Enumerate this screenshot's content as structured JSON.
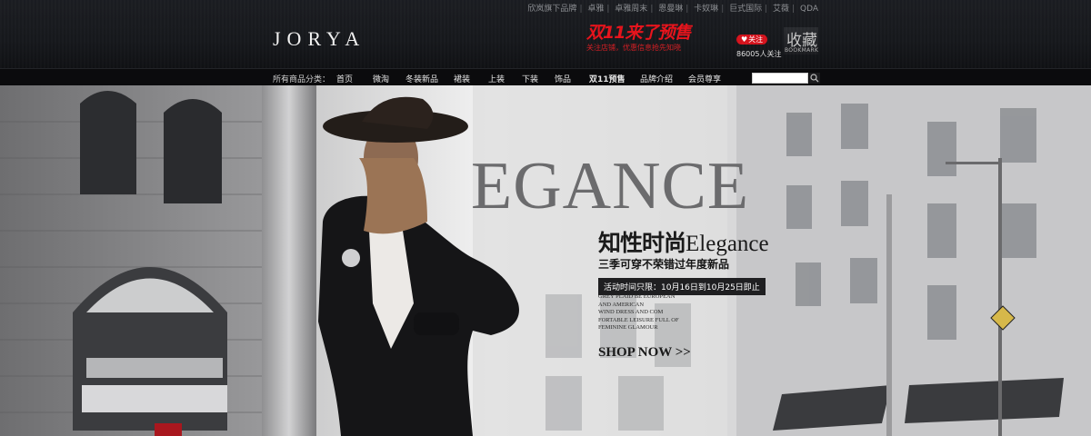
{
  "top_links": [
    "欣岚旗下品牌",
    "卓雅",
    "卓雅周末",
    "恩曼琳",
    "卡奴琳",
    "巨式国际",
    "艾薇",
    "QDA"
  ],
  "brand": {
    "logo": "JORYA"
  },
  "promo": {
    "title": "双11来了预售",
    "subtitle": "关注店铺，优惠信息抢先知晓"
  },
  "follow": {
    "button": "关注",
    "count": "86005人关注"
  },
  "bookmark": {
    "big": "收藏",
    "small": "BOOKMARK"
  },
  "nav": {
    "category_label": "所有商品分类：",
    "items": [
      "首页",
      "微淘",
      "冬装新品",
      "裙装",
      "上装",
      "下装",
      "饰品",
      "双11预售",
      "品牌介绍",
      "会员尊享"
    ]
  },
  "search": {
    "value": ""
  },
  "banner": {
    "headline": "EGANCE",
    "tagline_cn": "知性时尚",
    "tagline_en": "Elegance",
    "subline": "三季可穿不荣错过年度新品",
    "date": "活动时间只限：10月16日到10月25日即止",
    "desc": [
      "GREY PLAID BE EUROPEAN",
      "AND AMERICAN",
      "WIND DRESS AND COM",
      "FORTABLE LEISURE FULL OF",
      "FEMININE GLAMOUR"
    ],
    "cta": "SHOP NOW >>"
  },
  "colors": {
    "accent_red": "#e8121b",
    "header_bg": "#16181c",
    "nav_bg": "#0b0b0d"
  }
}
